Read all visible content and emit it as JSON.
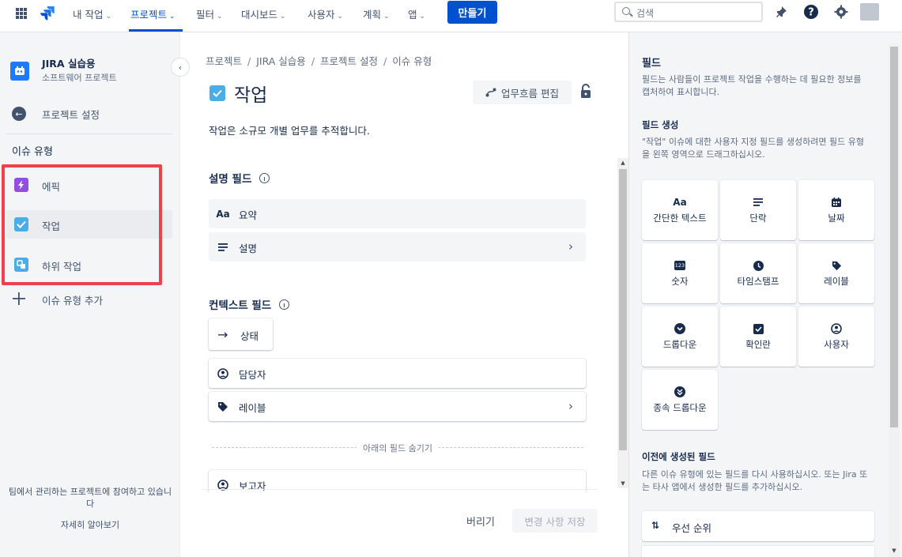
{
  "topnav": {
    "items": [
      {
        "label": "내 작업",
        "chevron": "⌄"
      },
      {
        "label": "프로젝트",
        "chevron": "⌄"
      },
      {
        "label": "필터",
        "chevron": "⌄"
      },
      {
        "label": "대시보드",
        "chevron": "⌄"
      },
      {
        "label": "사용자",
        "chevron": "⌄"
      },
      {
        "label": "계획",
        "chevron": "⌄"
      },
      {
        "label": "앱",
        "chevron": "⌄"
      }
    ],
    "active_item": "프로젝트",
    "create_label": "만들기",
    "search_placeholder": "검색",
    "accent_color": "#0052cc"
  },
  "sidebar": {
    "project_name": "JIRA 실습용",
    "project_type": "소프트웨어 프로젝트",
    "collapse_icon": "‹",
    "back_icon": "←",
    "back_label": "프로젝트 설정",
    "section_title": "이슈 유형",
    "items": [
      {
        "label": "에픽",
        "icon": "lightning-icon",
        "color": "#904ee2"
      },
      {
        "label": "작업",
        "icon": "checkbox-icon",
        "color": "#4bade8",
        "selected": true
      },
      {
        "label": "하위 작업",
        "icon": "subtask-icon",
        "color": "#4bade8"
      }
    ],
    "add_label": "이슈 유형 추가",
    "footer_text": "팀에서 관리하는 프로젝트에 참여하고 있습니다",
    "learn_more": "자세히 알아보기",
    "highlight_color": "#f0414a"
  },
  "main": {
    "breadcrumb": [
      "프로젝트",
      "JIRA 실습용",
      "프로젝트 설정",
      "이슈 유형"
    ],
    "breadcrumb_sep": "/",
    "title": "작업",
    "workflow_button": "업무흐름 편집",
    "description": "작업은 소규모 개별 업무를 추적합니다.",
    "description_fields_title": "설명 필드",
    "description_fields": [
      {
        "label": "요약",
        "icon": "text-aa-icon",
        "icon_text": "Aa",
        "arrow": ""
      },
      {
        "label": "설명",
        "icon": "paragraph-icon",
        "arrow": "›"
      }
    ],
    "context_fields_title": "컨텍스트 필드",
    "status_icon": "→",
    "status_label": "상태",
    "context_fields": [
      {
        "label": "담당자",
        "icon": "person-icon",
        "arrow": ""
      },
      {
        "label": "레이블",
        "icon": "tag-icon",
        "arrow": "›"
      }
    ],
    "hide_fields_label": "아래의 필드 숨기기",
    "hidden_fields": [
      {
        "label": "보고자",
        "icon": "person-icon"
      }
    ],
    "scroll_up": "▲",
    "scroll_down": "▼",
    "discard_label": "버리기",
    "save_label": "변경 사항 저장"
  },
  "rpanel": {
    "title": "필드",
    "intro": "필드는 사람들이 프로젝트 작업을 수행하는 데 필요한 정보를 캡처하여 표시합니다.",
    "create_title": "필드 생성",
    "create_desc": "\"작업\" 이슈에 대한 사용자 지정 필드를 생성하려면 필드 유형을 왼쪽 영역으로 드래그하십시오.",
    "field_types": [
      {
        "label": "간단한 텍스트",
        "icon": "text-aa-icon",
        "icon_text": "Aa"
      },
      {
        "label": "단락",
        "icon": "paragraph-icon"
      },
      {
        "label": "날짜",
        "icon": "calendar-icon"
      },
      {
        "label": "숫자",
        "icon": "number-icon",
        "icon_text": "123"
      },
      {
        "label": "타임스탬프",
        "icon": "clock-icon"
      },
      {
        "label": "레이블",
        "icon": "tag-icon"
      },
      {
        "label": "드롭다운",
        "icon": "dropdown-icon"
      },
      {
        "label": "확인란",
        "icon": "checkbox-icon"
      },
      {
        "label": "사용자",
        "icon": "person-icon"
      },
      {
        "label": "종속 드롭다운",
        "icon": "cascade-dropdown-icon"
      }
    ],
    "previous_title": "이전에 생성된 필드",
    "previous_desc": "다른 이슈 유형에 있는 필드를 다시 사용하십시오. 또는 Jira 또는 타사 앱에서 생성한 필드를 추가하십시오.",
    "priority_icon": "⇅",
    "priority_label": "우선 순위",
    "scroll_down": "▼"
  }
}
